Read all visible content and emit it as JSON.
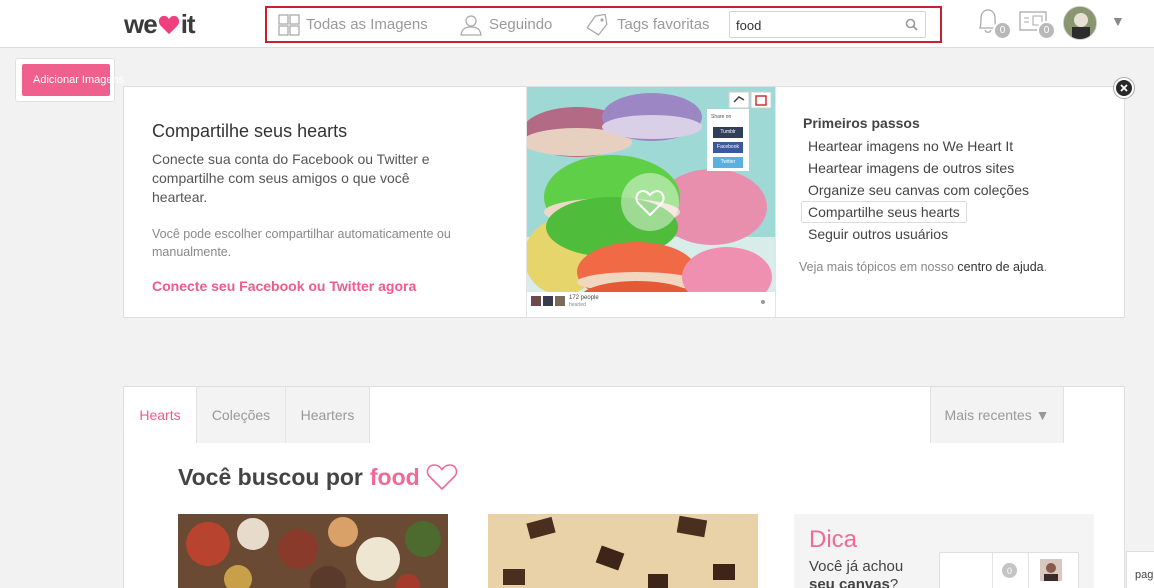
{
  "brand": {
    "logo_left": "we",
    "logo_right": "it",
    "accent": "#ef5b8c"
  },
  "nav": {
    "all_images": "Todas as Imagens",
    "following": "Seguindo",
    "fav_tags": "Tags favoritas",
    "search_value": "food"
  },
  "header": {
    "notifications_count": "0",
    "messages_count": "0"
  },
  "add_button": "Adicionar Imagens",
  "welcome": {
    "title": "Compartilhe seus hearts",
    "description": "Conecte sua conta do Facebook ou Twitter e compartilhe com seus amigos o que você heartear.",
    "note": "Você pode escolher compartilhar automaticamente ou manualmente.",
    "link": "Conecte seu Facebook ou Twitter agora",
    "promo": {
      "share_on": "Share on",
      "tumblr": "Tumblr",
      "facebook": "Facebook",
      "twitter": "Twitter",
      "people_count": "172 people",
      "people_label": "hearted"
    }
  },
  "steps": {
    "title": "Primeiros passos",
    "items": [
      "Heartear imagens no We Heart It",
      "Heartear imagens de outros sites",
      "Organize seu canvas com coleções",
      "Compartilhe seus hearts",
      "Seguir outros usuários"
    ],
    "more_prefix": "Veja mais tópicos em nosso ",
    "more_link": "centro de ajuda",
    "more_suffix": "."
  },
  "results": {
    "tabs": [
      "Hearts",
      "Coleções",
      "Hearters"
    ],
    "sort_label": "Mais recentes ▼",
    "search_prefix": "Você buscou por",
    "query": "food"
  },
  "tip": {
    "title": "Dica",
    "text_prefix": "Você já achou",
    "text_bold": "seu canvas",
    "text_suffix": "?",
    "mini_count": "0"
  },
  "edge_text": "pag"
}
